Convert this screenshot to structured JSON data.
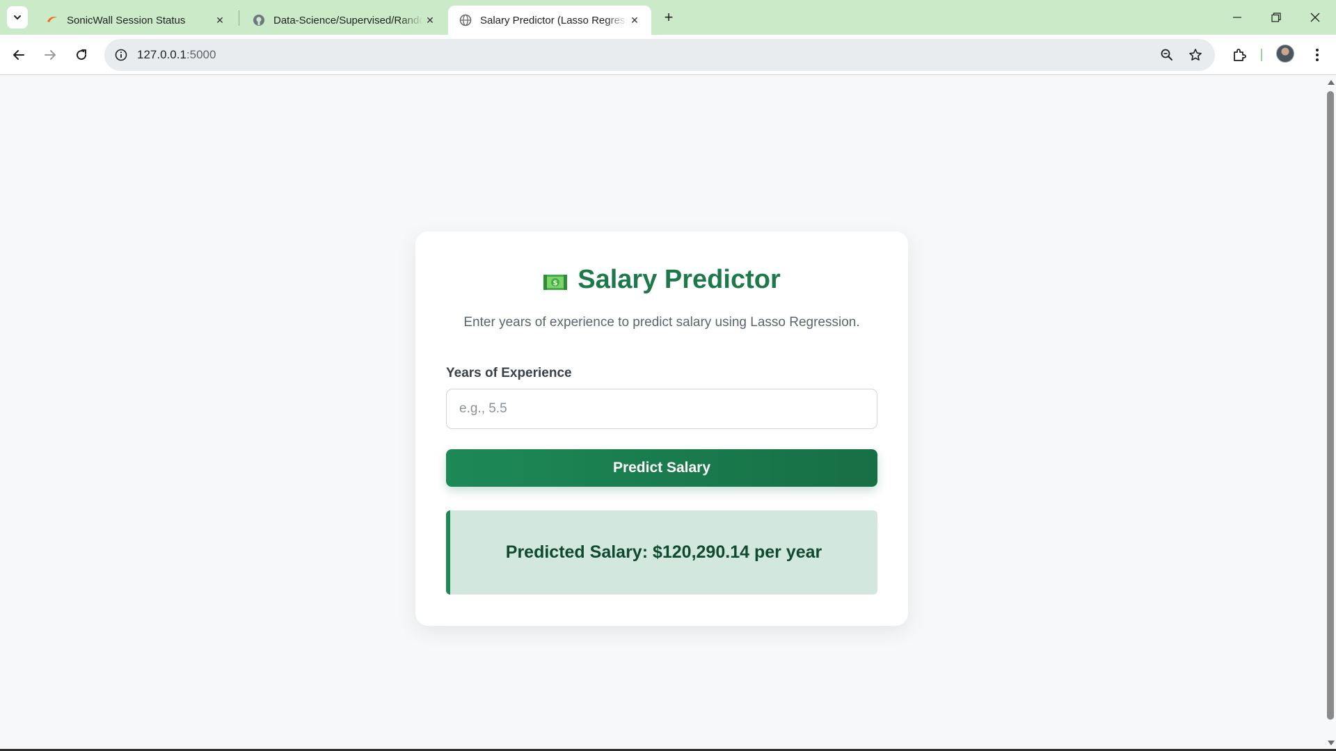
{
  "browser": {
    "tabs": [
      {
        "title": "SonicWall Session Status",
        "favicon": "sonicwall-icon"
      },
      {
        "title": "Data-Science/Supervised/Random",
        "favicon": "github-icon"
      },
      {
        "title": "Salary Predictor (Lasso Regression)",
        "favicon": "globe-icon",
        "active": true
      }
    ],
    "new_tab_label": "+",
    "url_host": "127.0.0.1",
    "url_port": ":5000"
  },
  "app": {
    "title": "Salary Predictor",
    "title_icon": "money-icon",
    "subtitle": "Enter years of experience to predict salary using Lasso Regression.",
    "input_label": "Years of Experience",
    "input_placeholder": "e.g., 5.5",
    "button_label": "Predict Salary",
    "result_text": "Predicted Salary: $120,290.14 per year"
  },
  "colors": {
    "accent": "#1c7a4a",
    "tabstrip": "#cbeac7",
    "result_bg": "#d2e8de"
  }
}
